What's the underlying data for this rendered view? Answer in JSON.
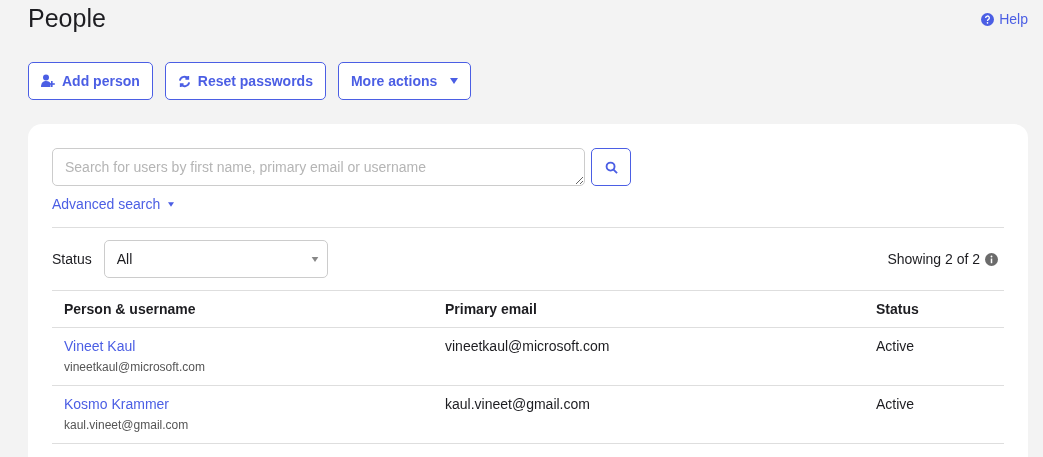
{
  "title": "People",
  "help": "Help",
  "actions": [
    {
      "kind": "add-person",
      "label": "Add person"
    },
    {
      "kind": "reset",
      "label": "Reset passwords"
    },
    {
      "kind": "menu",
      "label": "More actions"
    }
  ],
  "search": {
    "placeholder": "Search for users by first name, primary email or username",
    "advanced": "Advanced search"
  },
  "filter": {
    "label": "Status",
    "value": "All"
  },
  "count": "Showing 2 of 2",
  "table": {
    "columns": [
      "Person & username",
      "Primary email",
      "Status"
    ],
    "rows": [
      {
        "name": "Vineet Kaul",
        "username": "vineetkaul@microsoft.com",
        "email": "vineetkaul@microsoft.com",
        "status": "Active"
      },
      {
        "name": "Kosmo Krammer",
        "username": "kaul.vineet@gmail.com",
        "email": "kaul.vineet@gmail.com",
        "status": "Active"
      }
    ]
  }
}
